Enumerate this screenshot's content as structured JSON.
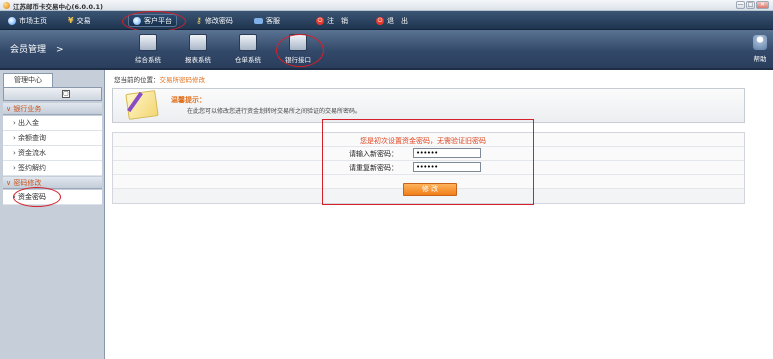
{
  "window": {
    "title": "江苏邮币卡交易中心(6.0.0.1)",
    "buttons": [
      "—",
      "□",
      "✕"
    ]
  },
  "topnav": {
    "items": [
      {
        "label": "市场主页",
        "icon": "globe-icon"
      },
      {
        "label": "交易",
        "icon": "yen-icon"
      },
      {
        "label": "客户平台",
        "icon": "client-icon",
        "active": true
      },
      {
        "label": "修改密码",
        "icon": "key-icon"
      },
      {
        "label": "客服",
        "icon": "service-icon"
      },
      {
        "label": "注　销",
        "icon": "power-icon"
      },
      {
        "label": "退　出",
        "icon": "power-icon"
      }
    ]
  },
  "subnav": {
    "member_label": "会员管理",
    "member_chevron": ">",
    "systems": [
      {
        "label": "综合系统"
      },
      {
        "label": "报表系统"
      },
      {
        "label": "仓单系统"
      },
      {
        "label": "银行接口",
        "active": true
      }
    ],
    "help_label": "帮助"
  },
  "sidebar": {
    "tab_label": "管理中心",
    "groups": [
      {
        "title": "银行业务",
        "items": [
          "出入金",
          "余额查询",
          "资金流水",
          "签约解约"
        ]
      },
      {
        "title": "密码修改",
        "items": [
          "资金密码"
        ]
      }
    ],
    "active_item": "资金密码"
  },
  "content": {
    "location_prefix": "您当前的位置：",
    "location_link": "交易所密码修改",
    "tip_title": "温馨提示：",
    "tip_text": "在此您可以修改您进行资金划转时交易所之间验证的交易所密码。",
    "notice": "您是初次设置资金密码，无需验证旧密码",
    "new_password_label": "请输入新密码：",
    "new_password_value": "••••••",
    "confirm_password_label": "请重复新密码：",
    "confirm_password_value": "••••••",
    "submit_label": "修 改"
  },
  "colors": {
    "accent_orange": "#e0701d",
    "nav_dark": "#1f3550",
    "highlight_red": "#d4202a"
  }
}
